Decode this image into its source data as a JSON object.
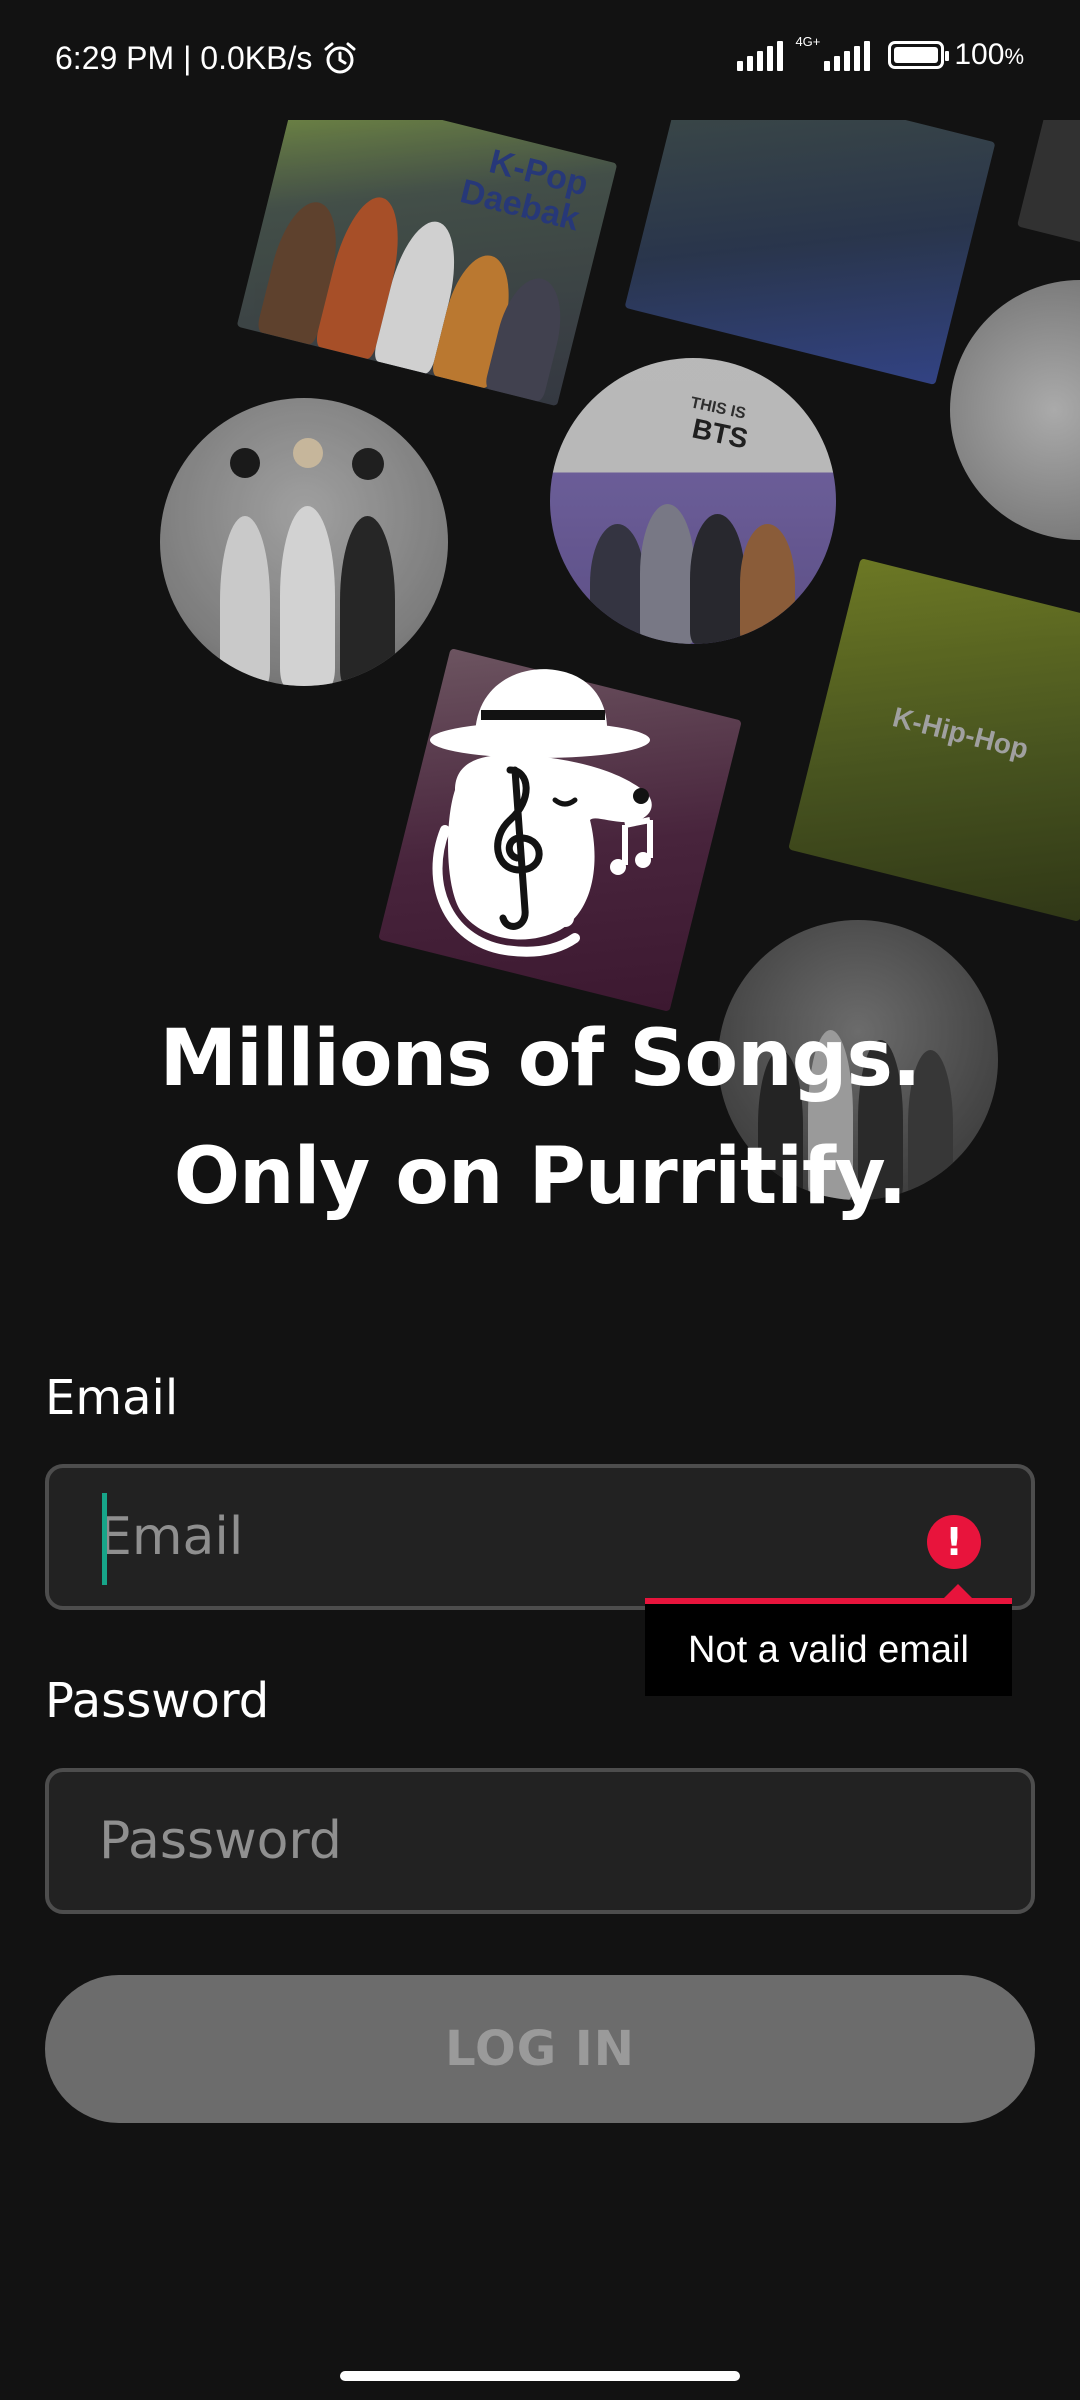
{
  "status_bar": {
    "time_speed": "6:29 PM | 0.0KB/s",
    "network_type": "4G+",
    "battery": "100",
    "battery_unit": "%"
  },
  "hero": {
    "tiles": {
      "kpop_daebak": "K-Pop Daebak",
      "this_is_bts_small": "THIS IS",
      "this_is_bts_large": "BTS",
      "k_hip_hop": "K-Hip-Hop"
    },
    "headline_line1": "Millions of Songs.",
    "headline_line2": "Only on Purritify."
  },
  "form": {
    "email_label": "Email",
    "email_placeholder": "Email",
    "email_value": "",
    "email_error": "Not a valid email",
    "password_label": "Password",
    "password_placeholder": "Password",
    "password_value": "",
    "login_label": "LOG IN"
  },
  "colors": {
    "background": "#121212",
    "input_background": "#222222",
    "input_border": "#4d4d4d",
    "error": "#e8143c",
    "caret": "#17a589",
    "button_disabled": "#6c6c6c"
  },
  "icons": [
    "alarm-icon",
    "signal-icon",
    "battery-icon",
    "error-icon",
    "purritify-logo"
  ]
}
